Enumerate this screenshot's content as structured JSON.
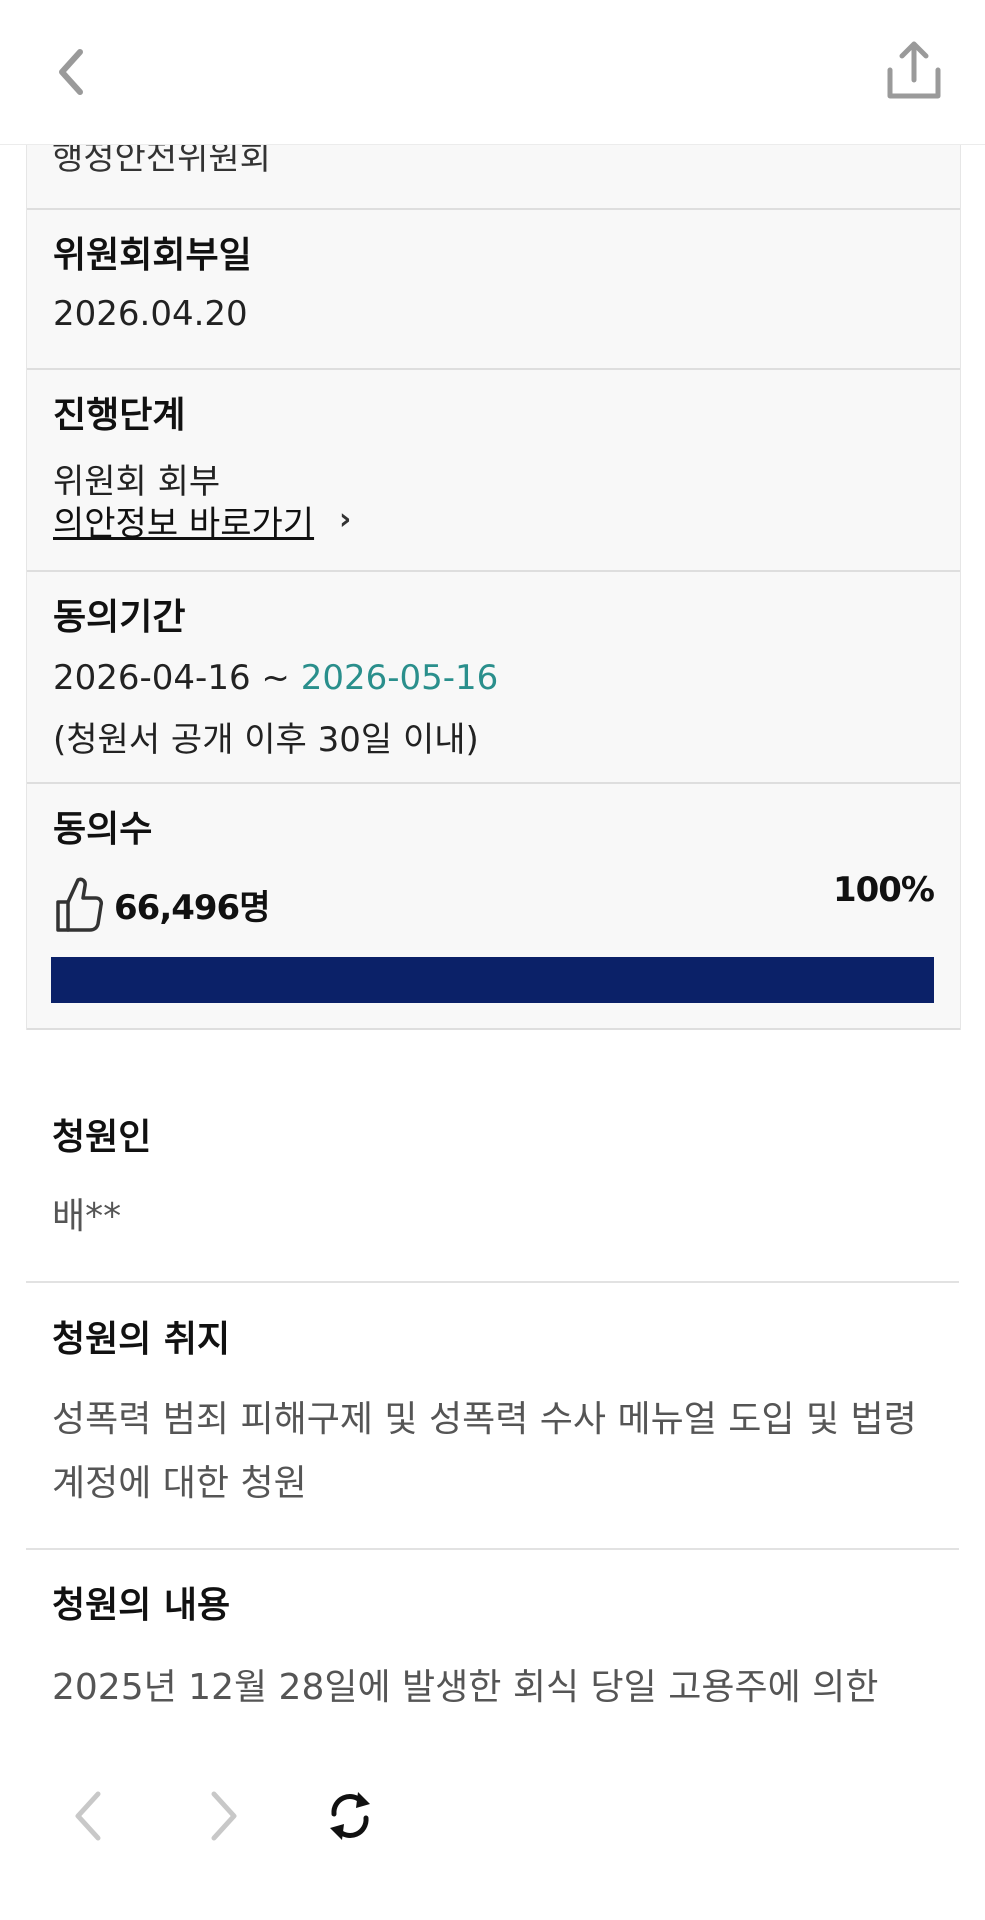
{
  "header": {
    "back_icon": "chevron-left-icon",
    "share_icon": "share-icon"
  },
  "info": {
    "committee_partial": "행정안전위원회",
    "referral_label": "위원회회부일",
    "referral_date": "2026.04.20",
    "stage_label": "진행단계",
    "stage_value": "위원회 회부",
    "bill_link": "의안정보 바로가기",
    "period_label": "동의기간",
    "period_start": "2026-04-16 ~ ",
    "period_end": "2026-05-16",
    "period_note": "(청원서 공개 이후 30일 이내)",
    "count_label": "동의수",
    "count_value": "66,496명",
    "percent": "100%",
    "progress_fraction": 1.0,
    "colors": {
      "progress": "#0b2168",
      "teal": "#2a8f8c"
    }
  },
  "petitioner": {
    "label": "청원인",
    "value": "배**"
  },
  "purpose": {
    "label": "청원의 취지",
    "text": "성폭력 범죄 피해구제 및 성폭력 수사 메뉴얼 도입 및 법령계정에 대한 청원"
  },
  "content": {
    "label": "청원의 내용",
    "text": "2025년 12월 28일에 발생한 회식 당일 고용주에 의한"
  },
  "bottom_nav": {
    "back_icon": "chevron-left-icon",
    "forward_icon": "chevron-right-icon",
    "refresh_icon": "refresh-icon"
  }
}
